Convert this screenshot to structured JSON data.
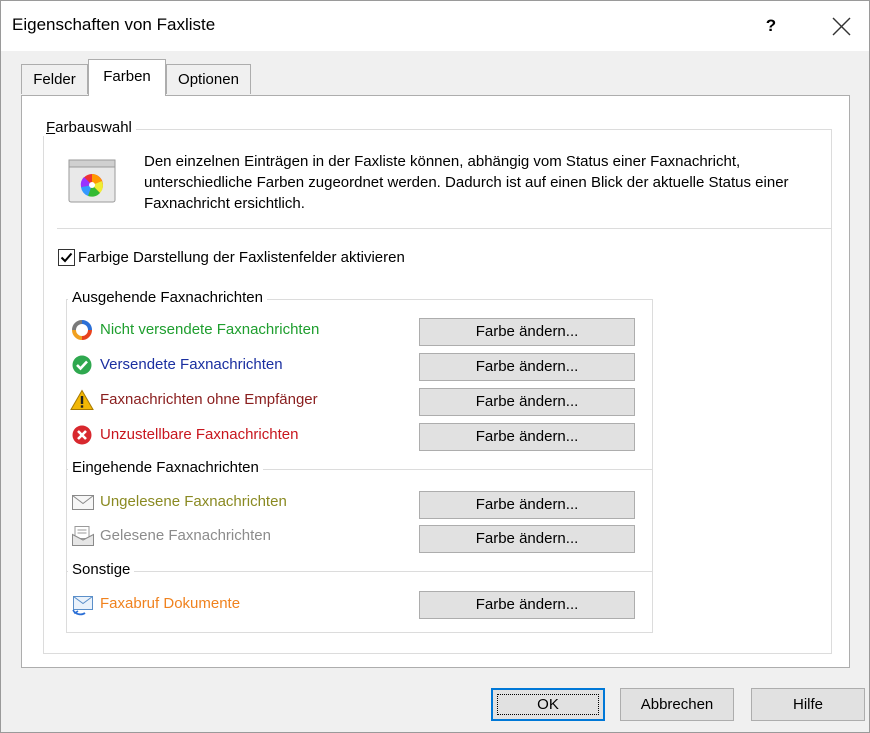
{
  "window": {
    "title": "Eigenschaften von Faxliste",
    "help_glyph": "?",
    "close_glyph": "✕"
  },
  "tabs": [
    {
      "label": "Felder",
      "active": false
    },
    {
      "label": "Farben",
      "active": true
    },
    {
      "label": "Optionen",
      "active": false
    }
  ],
  "farbauswahl": {
    "group_label": "Farbauswahl",
    "description": "Den einzelnen Einträgen in der Faxliste können, abhängig vom Status einer Faxnachricht, unterschiedliche Farben zugeordnet werden. Dadurch ist auf einen Blick der aktuelle Status einer Faxnachricht ersichtlich.",
    "checkbox_label": "Farbige Darstellung der Faxlistenfelder aktivieren",
    "checkbox_checked": true
  },
  "sections": {
    "outgoing": {
      "label": "Ausgehende Faxnachrichten",
      "items": [
        {
          "label": "Nicht versendete Faxnachrichten",
          "color": "#1e9e2e",
          "icon": "sync-icon",
          "button": "Farbe ändern..."
        },
        {
          "label": "Versendete Faxnachrichten",
          "color": "#1a2fa0",
          "icon": "check-circle-icon",
          "button": "Farbe ändern..."
        },
        {
          "label": "Faxnachrichten ohne Empfänger",
          "color": "#8a1e1e",
          "icon": "warning-icon",
          "button": "Farbe ändern..."
        },
        {
          "label": "Unzustellbare Faxnachrichten",
          "color": "#c8161e",
          "icon": "error-circle-icon",
          "button": "Farbe ändern..."
        }
      ]
    },
    "incoming": {
      "label": "Eingehende Faxnachrichten",
      "items": [
        {
          "label": "Ungelesene Faxnachrichten",
          "color": "#8a8a22",
          "icon": "envelope-icon",
          "button": "Farbe ändern..."
        },
        {
          "label": "Gelesene Faxnachrichten",
          "color": "#8c8c8c",
          "icon": "read-document-icon",
          "button": "Farbe ändern..."
        }
      ]
    },
    "other": {
      "label": "Sonstige",
      "items": [
        {
          "label": "Faxabruf Dokumente",
          "color": "#f0821e",
          "icon": "fax-poll-icon",
          "button": "Farbe ändern..."
        }
      ]
    }
  },
  "footer": {
    "ok": "OK",
    "cancel": "Abbrechen",
    "help": "Hilfe"
  }
}
